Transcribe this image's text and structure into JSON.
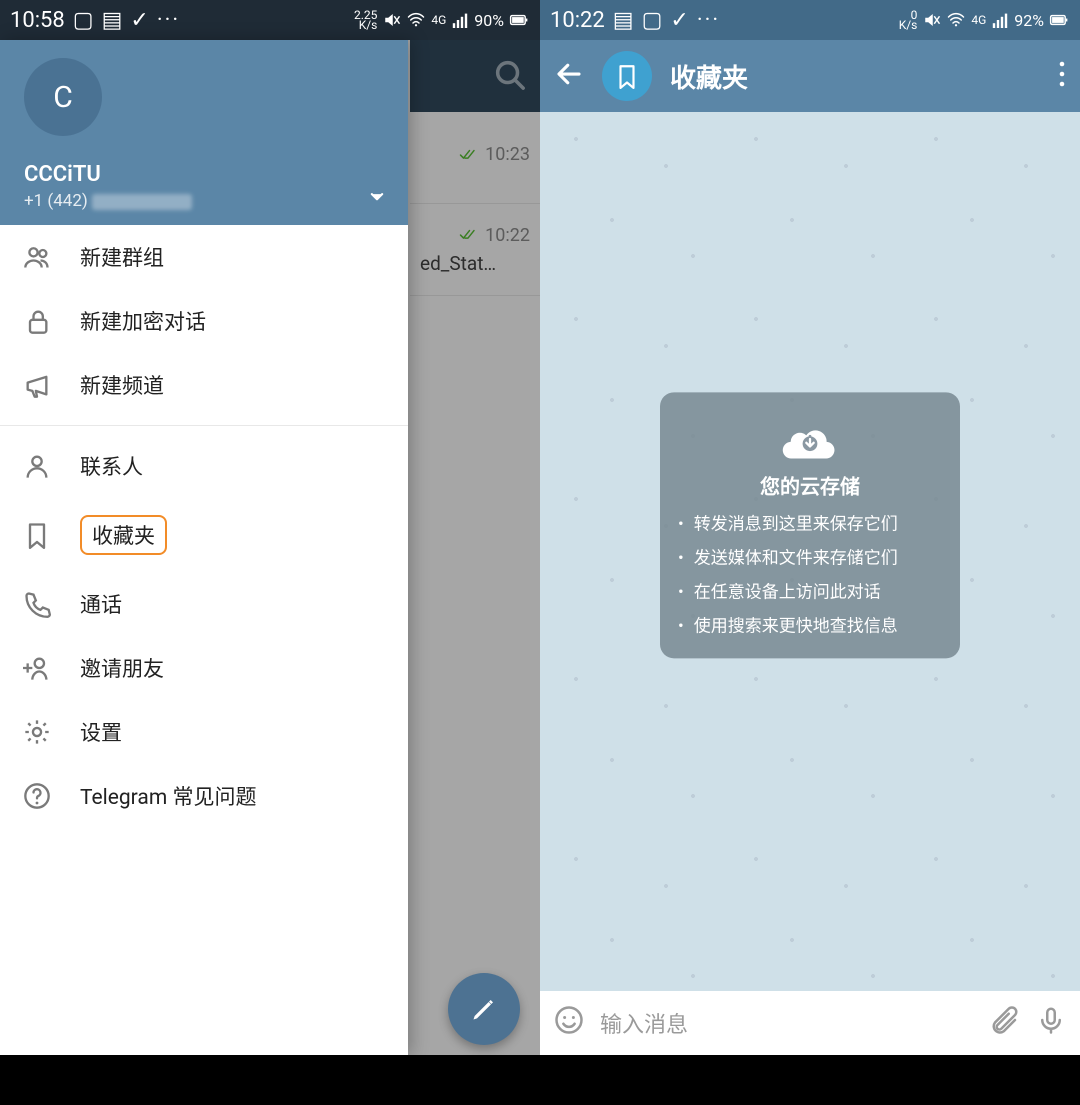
{
  "left": {
    "status": {
      "time": "10:58",
      "kbs_top": "2.25",
      "kbs_bot": "K/s",
      "net": "4G",
      "battery": "90%"
    },
    "profile": {
      "initial": "C",
      "name": "CCCiTU",
      "phone_prefix": "+1 (442)"
    },
    "menu": {
      "group1": [
        {
          "key": "new_group",
          "label": "新建群组",
          "icon": "group"
        },
        {
          "key": "new_secret",
          "label": "新建加密对话",
          "icon": "lock"
        },
        {
          "key": "new_channel",
          "label": "新建频道",
          "icon": "megaphone"
        }
      ],
      "group2": [
        {
          "key": "contacts",
          "label": "联系人",
          "icon": "person"
        },
        {
          "key": "saved",
          "label": "收藏夹",
          "icon": "bookmark",
          "highlight": true
        },
        {
          "key": "calls",
          "label": "通话",
          "icon": "phone"
        },
        {
          "key": "invite",
          "label": "邀请朋友",
          "icon": "invite"
        },
        {
          "key": "settings",
          "label": "设置",
          "icon": "gear"
        },
        {
          "key": "faq",
          "label": "Telegram 常见问题",
          "icon": "help"
        }
      ]
    },
    "chat_preview": {
      "rows": [
        {
          "time": "10:23",
          "snippet": ""
        },
        {
          "time": "10:22",
          "snippet": "ed_Stat…"
        }
      ]
    }
  },
  "right": {
    "status": {
      "time": "10:22",
      "kbs_top": "0",
      "kbs_bot": "K/s",
      "net": "4G",
      "battery": "92%"
    },
    "appbar": {
      "title": "收藏夹"
    },
    "card": {
      "title": "您的云存储",
      "points": [
        "转发消息到这里来保存它们",
        "发送媒体和文件来存储它们",
        "在任意设备上访问此对话",
        "使用搜索来更快地查找信息"
      ]
    },
    "input": {
      "placeholder": "输入消息"
    }
  }
}
